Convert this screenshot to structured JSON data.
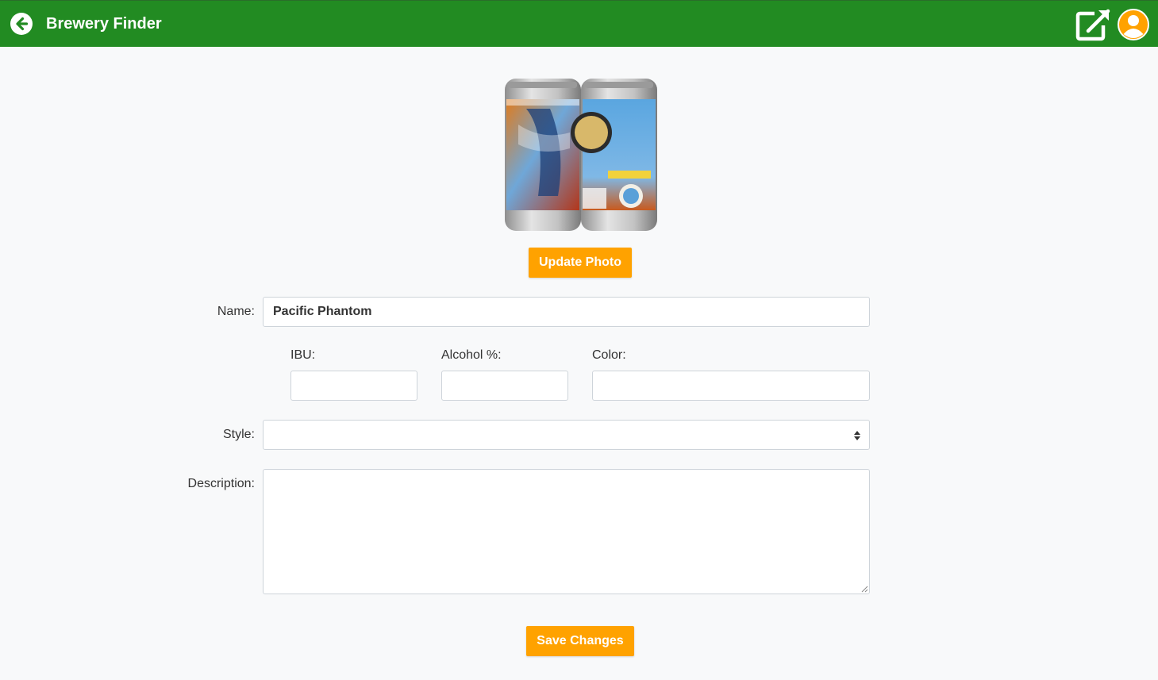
{
  "header": {
    "title": "Brewery Finder",
    "back_icon": "arrow-left-circle-icon",
    "edit_icon": "external-edit-icon",
    "profile_icon": "user-circle-icon"
  },
  "photo": {
    "alt": "Pacific Phantom beer cans"
  },
  "buttons": {
    "update_photo": "Update Photo",
    "save_changes": "Save Changes"
  },
  "form": {
    "name_label": "Name:",
    "name_value": "Pacific Phantom",
    "ibu_label": "IBU:",
    "ibu_value": "",
    "abv_label": "Alcohol %:",
    "abv_value": "",
    "color_label": "Color:",
    "color_value": "",
    "style_label": "Style:",
    "style_value": "",
    "description_label": "Description:",
    "description_value": ""
  },
  "colors": {
    "header_green": "#228b22",
    "accent_orange": "#ffa200",
    "background": "#f8f9fa"
  }
}
